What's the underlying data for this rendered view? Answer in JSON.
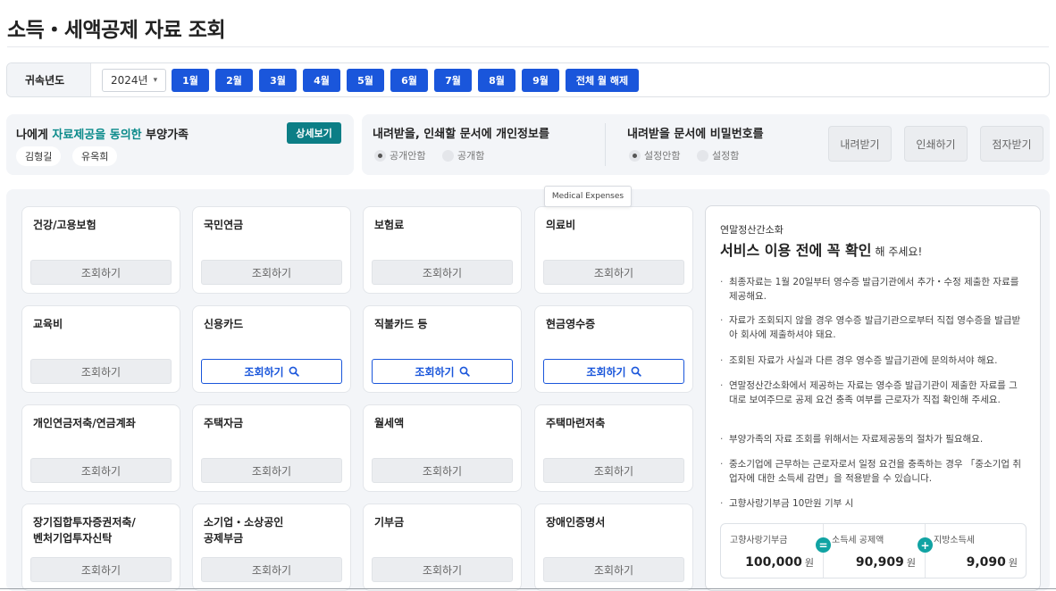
{
  "page": {
    "title": "소득・세액공제 자료 조회"
  },
  "year_bar": {
    "label": "귀속년도",
    "year_selected": "2024년",
    "months": [
      "1월",
      "2월",
      "3월",
      "4월",
      "5월",
      "6월",
      "7월",
      "8월",
      "9월"
    ],
    "clear_all": "전체 월 해제"
  },
  "consent": {
    "text_before": "나에게 ",
    "text_highlight": "자료제공을 동의한",
    "text_after": " 부양가족",
    "detail_button": "상세보기",
    "family": [
      "김형길",
      "유옥희"
    ]
  },
  "options": {
    "personal_info": {
      "heading": "내려받을, 인쇄할 문서에 개인정보를",
      "choices": [
        "공개안함",
        "공개함"
      ],
      "selected": "공개안함"
    },
    "password": {
      "heading": "내려받을 문서에 비밀번호를",
      "choices": [
        "설정안함",
        "설정함"
      ],
      "selected": "설정안함"
    },
    "actions": [
      "내려받기",
      "인쇄하기",
      "점자받기"
    ]
  },
  "tooltip": "Medical Expenses",
  "categories": [
    {
      "name": "건강/고용보험",
      "button": "조회하기",
      "active": false
    },
    {
      "name": "국민연금",
      "button": "조회하기",
      "active": false
    },
    {
      "name": "보험료",
      "button": "조회하기",
      "active": false
    },
    {
      "name": "의료비",
      "button": "조회하기",
      "active": false
    },
    {
      "name": "교육비",
      "button": "조회하기",
      "active": false
    },
    {
      "name": "신용카드",
      "button": "조회하기",
      "active": true
    },
    {
      "name": "직불카드 등",
      "button": "조회하기",
      "active": true
    },
    {
      "name": "현금영수증",
      "button": "조회하기",
      "active": true
    },
    {
      "name": "개인연금저축/연금계좌",
      "button": "조회하기",
      "active": false
    },
    {
      "name": "주택자금",
      "button": "조회하기",
      "active": false
    },
    {
      "name": "월세액",
      "button": "조회하기",
      "active": false
    },
    {
      "name": "주택마련저축",
      "button": "조회하기",
      "active": false
    },
    {
      "name": "장기집합투자증권저축/\n벤처기업투자신탁",
      "button": "조회하기",
      "active": false
    },
    {
      "name": "소기업・소상공인\n공제부금",
      "button": "조회하기",
      "active": false
    },
    {
      "name": "기부금",
      "button": "조회하기",
      "active": false
    },
    {
      "name": "장애인증명서",
      "button": "조회하기",
      "active": false
    }
  ],
  "notice": {
    "subtitle": "연말정산간소화",
    "headline": "서비스 이용 전에 꼭 확인",
    "headline_tail": "해 주세요!",
    "bullets": [
      "최종자료는 1월 20일부터 영수증 발급기관에서 추가・수정 제출한 자료를 제공해요.",
      "자료가 조회되지 않을 경우 영수증 발급기관으로부터 직접 영수증을 발급받아 회사에 제출하셔야 돼요.",
      "조회된 자료가 사실과 다른 경우 영수증 발급기관에 문의하셔야 해요.",
      "연말정산간소화에서 제공하는 자료는 영수증 발급기관이 제출한 자료를 그대로 보여주므로 공제 요건 충족 여부를 근로자가 직접 확인해 주세요.",
      "부양가족의 자료 조회를 위해서는 자료제공동의 절차가 필요해요.",
      "중소기업에 근무하는 근로자로서 일정 요건을 충족하는 경우 「중소기업 취업자에 대한 소득세 감면」을 적용받을 수 있습니다.",
      "고향사랑기부금 10만원 기부 시"
    ],
    "calc": {
      "items": [
        {
          "label": "고향사랑기부금",
          "amount": "100,000",
          "unit": "원"
        },
        {
          "label": "소득세 공제액",
          "amount": "90,909",
          "unit": "원"
        },
        {
          "label": "지방소득세",
          "amount": "9,090",
          "unit": "원"
        }
      ],
      "op1": "=",
      "op2": "+"
    }
  },
  "colors": {
    "primary": "#1a56db",
    "teal": "#0c7e86",
    "highlight": "#0a8a8a"
  }
}
